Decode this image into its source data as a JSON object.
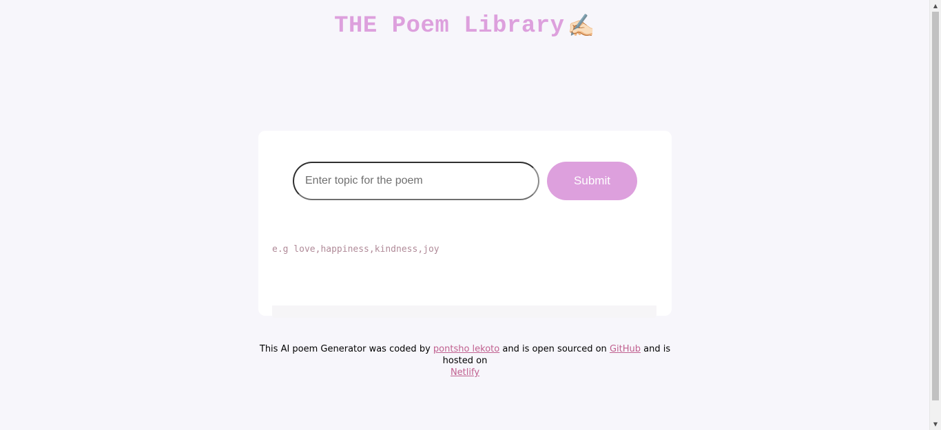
{
  "header": {
    "title": "THE Poem Library",
    "emoji": "✍🏻"
  },
  "form": {
    "input_placeholder": "Enter topic for the poem",
    "input_value": "",
    "submit_label": "Submit"
  },
  "hint": {
    "text": "e.g love,happiness,kindness,joy"
  },
  "footer": {
    "text_1": "This AI poem Generator was coded by ",
    "author_link": "pontsho lekoto",
    "text_2": " and is open sourced on ",
    "github_link": "GitHub",
    "text_3": " and is hosted on ",
    "netlify_link": "Netlify"
  },
  "colors": {
    "accent": "#dda0dd",
    "link": "#c0608f",
    "background": "#f7f6fb"
  }
}
